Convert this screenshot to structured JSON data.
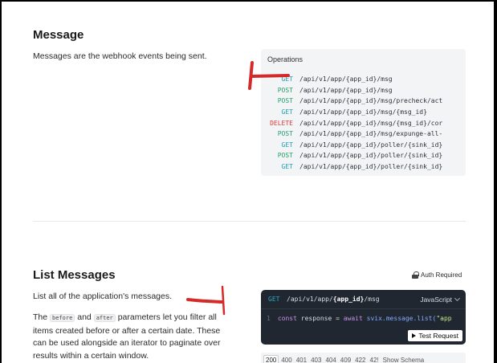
{
  "message_section": {
    "title": "Message",
    "description": "Messages are the webhook events being sent.",
    "operations_label": "Operations",
    "operations": [
      {
        "method": "GET",
        "path": "/api/v1/app/{app_id}/msg"
      },
      {
        "method": "POST",
        "path": "/api/v1/app/{app_id}/msg"
      },
      {
        "method": "POST",
        "path": "/api/v1/app/{app_id}/msg/precheck/act"
      },
      {
        "method": "GET",
        "path": "/api/v1/app/{app_id}/msg/{msg_id}"
      },
      {
        "method": "DELETE",
        "path": "/api/v1/app/{app_id}/msg/{msg_id}/cor"
      },
      {
        "method": "POST",
        "path": "/api/v1/app/{app_id}/msg/expunge-all-"
      },
      {
        "method": "GET",
        "path": "/api/v1/app/{app_id}/poller/{sink_id}"
      },
      {
        "method": "POST",
        "path": "/api/v1/app/{app_id}/poller/{sink_id}"
      },
      {
        "method": "GET",
        "path": "/api/v1/app/{app_id}/poller/{sink_id}"
      }
    ]
  },
  "list_section": {
    "title": "List Messages",
    "auth_label": "Auth Required",
    "intro": "List all of the application's messages.",
    "param_text_prefix": "The",
    "param_before": "before",
    "param_and": "and",
    "param_after": "after",
    "param_text_suffix": "parameters let you filter all items created before or after a certain date. These can be used alongside an iterator to paginate over results within a certain window.",
    "request": {
      "method": "GET",
      "path_prefix": "/api/v1/app/",
      "path_param": "{app_id}",
      "path_suffix": "/msg",
      "language": "JavaScript",
      "line_number": "1",
      "code_kw": "const",
      "code_var": "response",
      "code_eq": " = ",
      "code_await": "await",
      "code_call": "svix.message.list(",
      "code_str": "\"app",
      "test_button": "Test Request"
    },
    "status_codes": [
      "200",
      "400",
      "401",
      "403",
      "404",
      "409",
      "422",
      "42!"
    ],
    "show_schema": "Show Schema"
  },
  "colors": {
    "GET": "#1a9fb5",
    "POST": "#22a06b",
    "DELETE": "#d93a3a",
    "annotation": "#d42a2a"
  }
}
